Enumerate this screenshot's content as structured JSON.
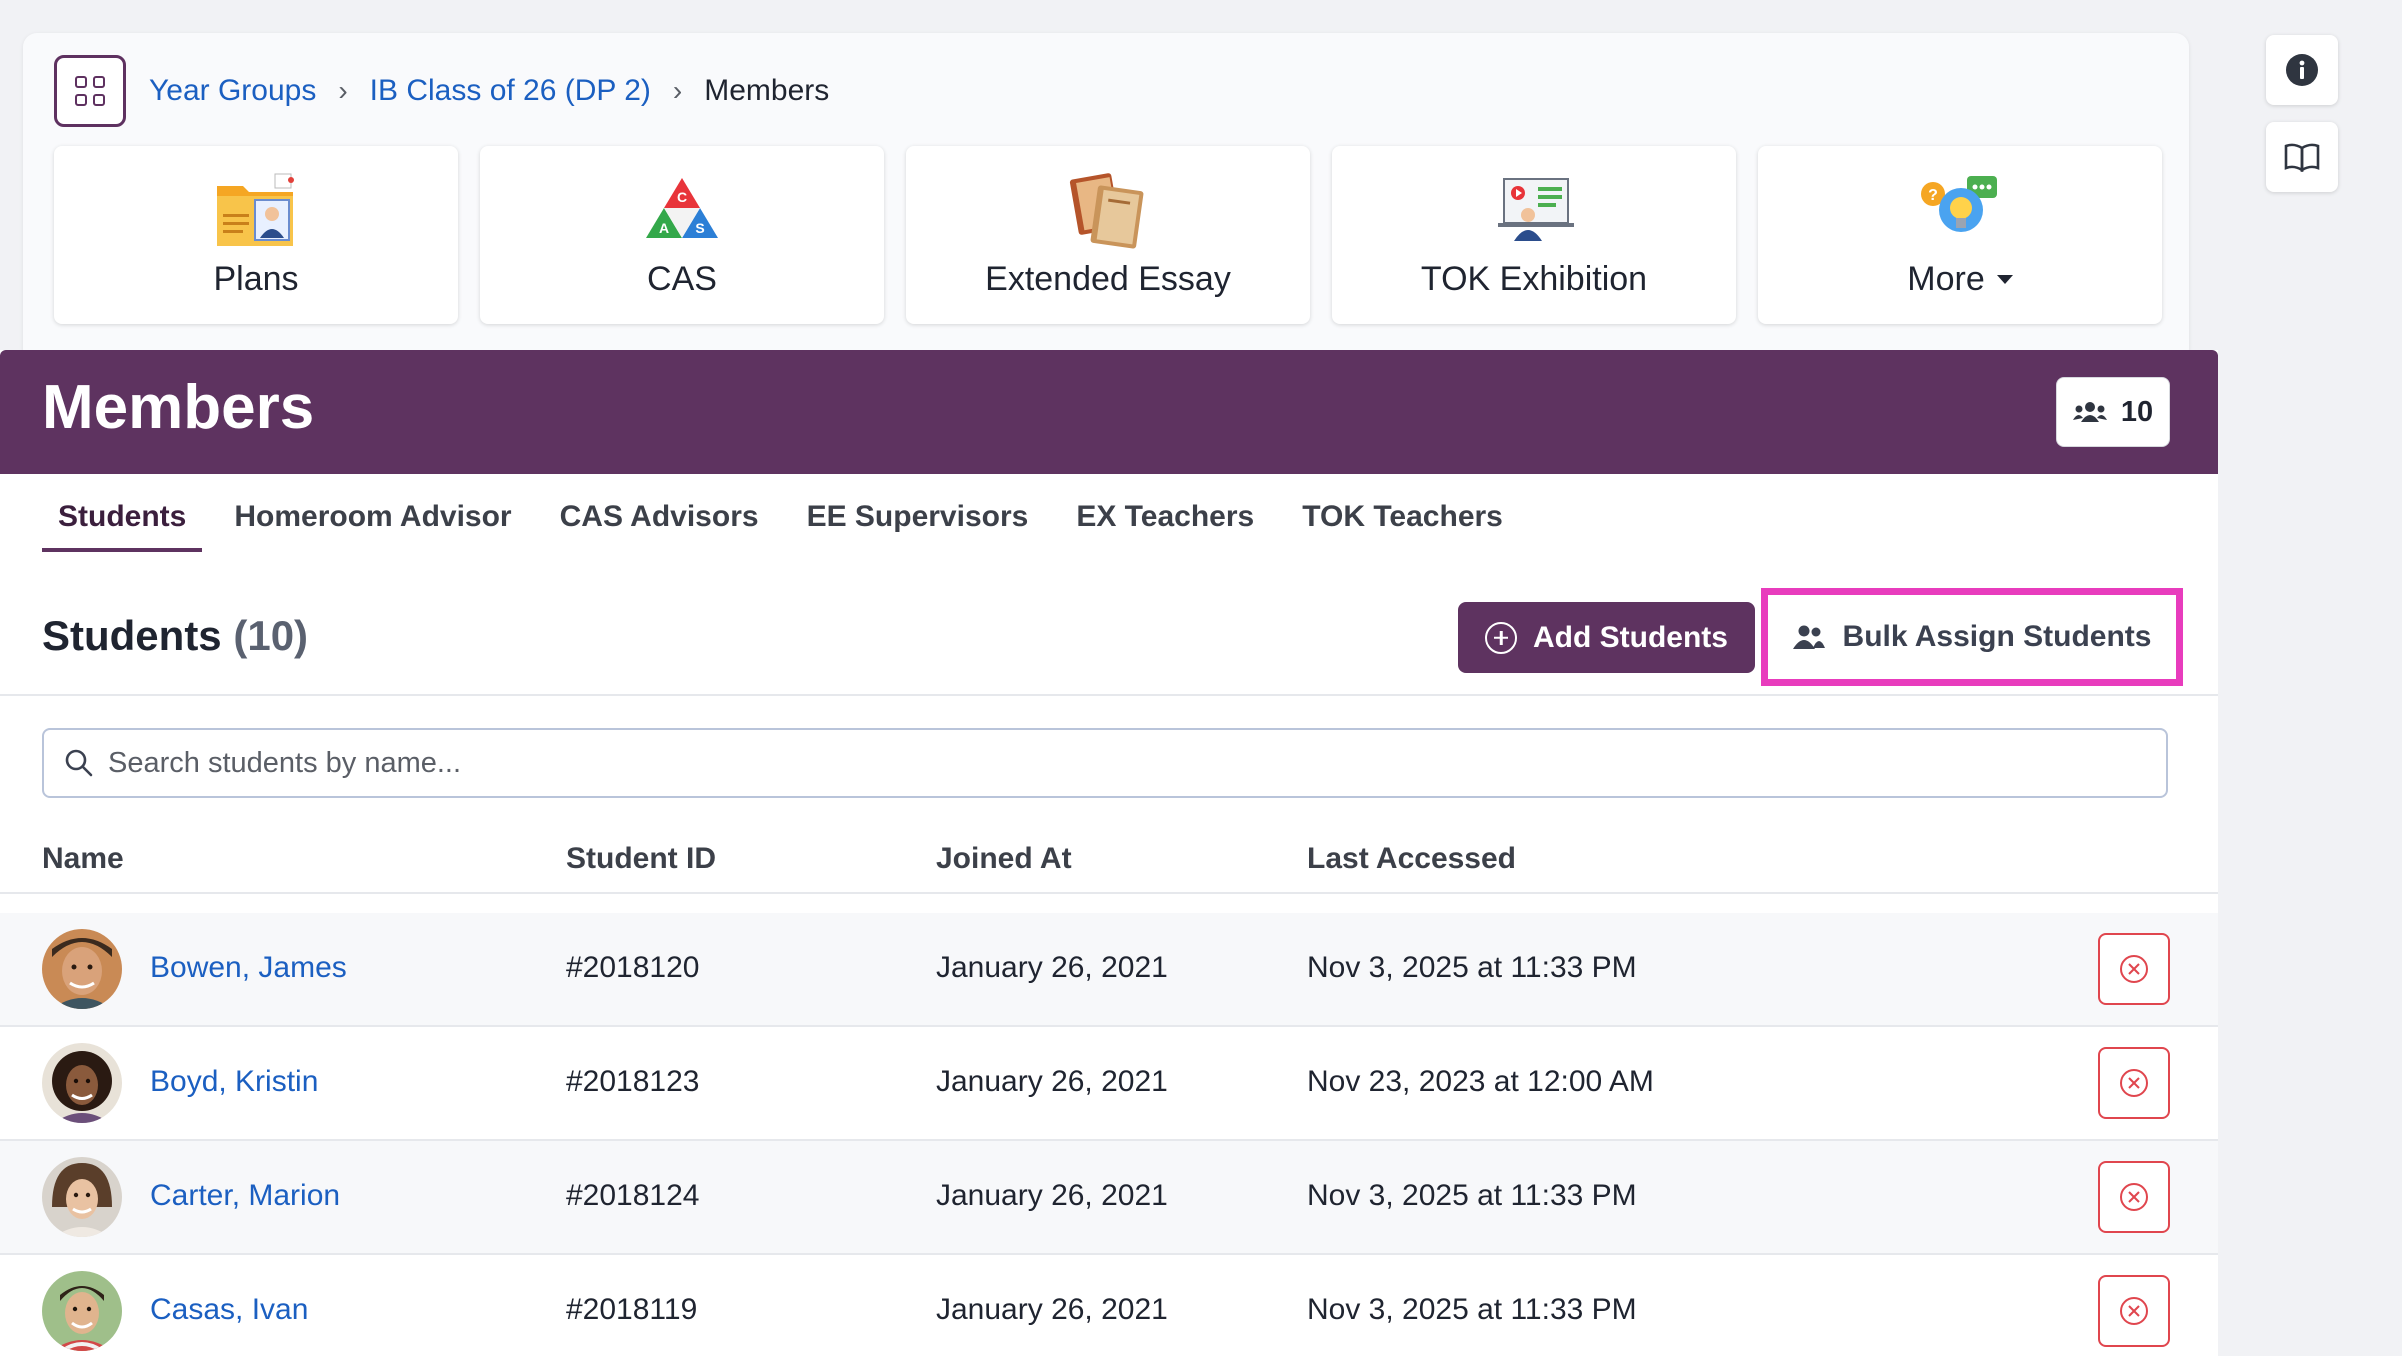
{
  "breadcrumb": {
    "items": [
      "Year Groups",
      "IB Class of 26 (DP 2)"
    ],
    "current": "Members"
  },
  "tiles": [
    {
      "label": "Plans",
      "icon": "folder-person-icon"
    },
    {
      "label": "CAS",
      "icon": "cas-triangle-icon"
    },
    {
      "label": "Extended Essay",
      "icon": "books-icon"
    },
    {
      "label": "TOK Exhibition",
      "icon": "presentation-icon"
    },
    {
      "label": "More",
      "icon": "lightbulb-chat-icon"
    }
  ],
  "side_buttons": [
    "info-icon",
    "book-icon"
  ],
  "members": {
    "title": "Members",
    "count": "10"
  },
  "tabs": [
    "Students",
    "Homeroom Advisor",
    "CAS Advisors",
    "EE Supervisors",
    "EX Teachers",
    "TOK Teachers"
  ],
  "section": {
    "title": "Students",
    "count": "(10)",
    "add_label": "Add Students",
    "bulk_label": "Bulk Assign Students"
  },
  "search": {
    "placeholder": "Search students by name..."
  },
  "table": {
    "headers": [
      "Name",
      "Student ID",
      "Joined At",
      "Last Accessed"
    ],
    "rows": [
      {
        "name": "Bowen, James",
        "id": "#2018120",
        "joined": "January 26, 2021",
        "last": "Nov 3, 2025 at 11:33 PM"
      },
      {
        "name": "Boyd, Kristin",
        "id": "#2018123",
        "joined": "January 26, 2021",
        "last": "Nov 23, 2023 at 12:00 AM"
      },
      {
        "name": "Carter, Marion",
        "id": "#2018124",
        "joined": "January 26, 2021",
        "last": "Nov 3, 2025 at 11:33 PM"
      },
      {
        "name": "Casas, Ivan",
        "id": "#2018119",
        "joined": "January 26, 2021",
        "last": "Nov 3, 2025 at 11:33 PM"
      }
    ]
  },
  "colors": {
    "brand": "#5e3360",
    "link": "#1b5fc1",
    "highlight": "#e83cbd",
    "danger": "#e0464e"
  }
}
